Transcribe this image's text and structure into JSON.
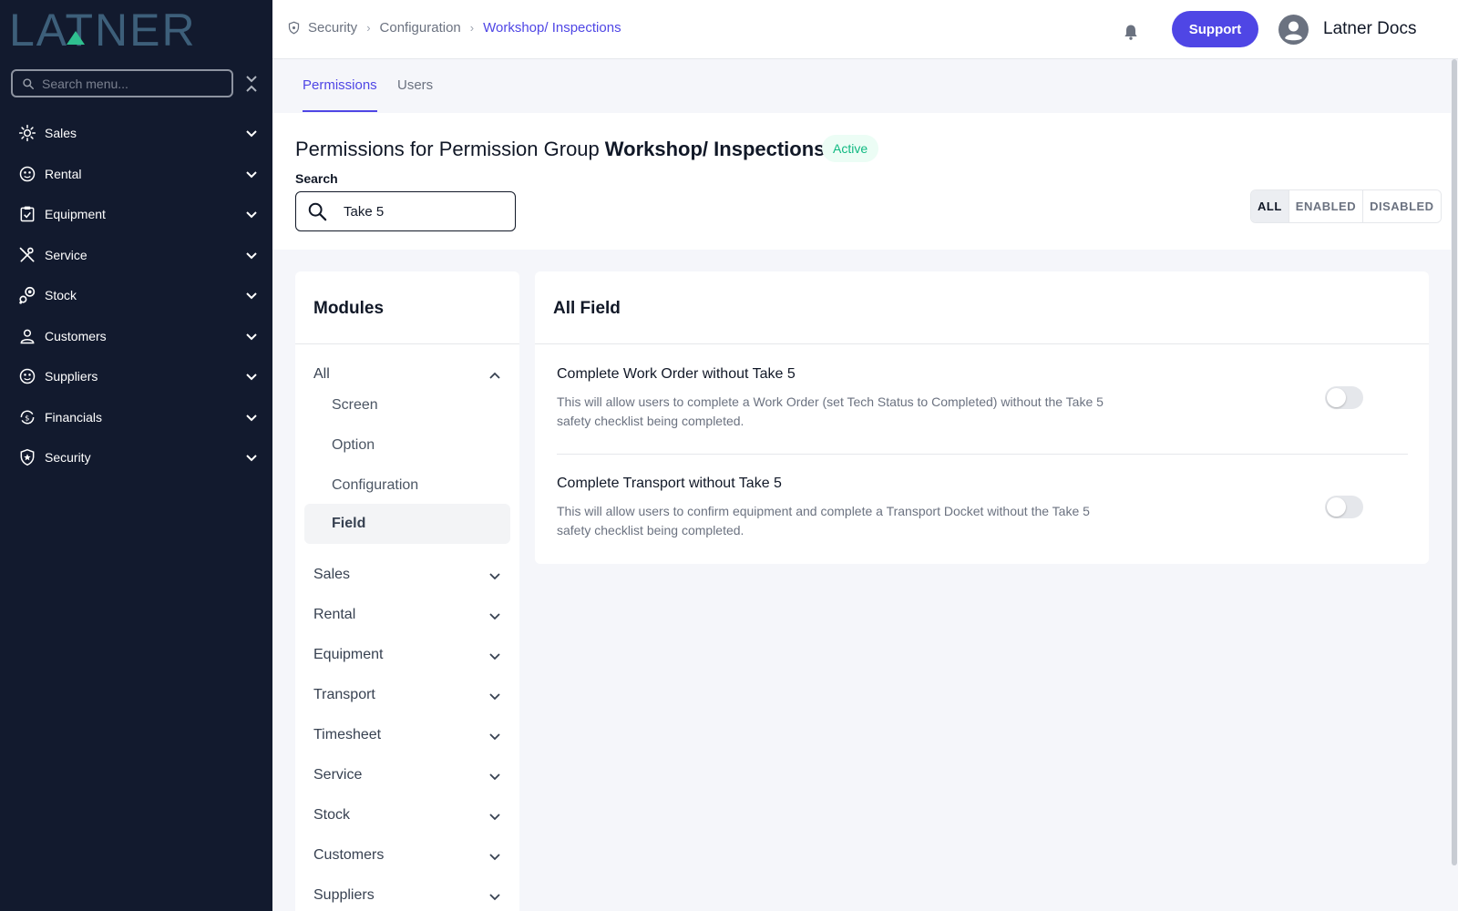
{
  "app": {
    "logo_text": "LATNER",
    "menu_search_placeholder": "Search menu..."
  },
  "sidebar": {
    "items": [
      {
        "label": "Sales",
        "icon": "sales-icon"
      },
      {
        "label": "Rental",
        "icon": "rental-icon"
      },
      {
        "label": "Equipment",
        "icon": "equipment-icon"
      },
      {
        "label": "Service",
        "icon": "service-icon"
      },
      {
        "label": "Stock",
        "icon": "stock-icon"
      },
      {
        "label": "Customers",
        "icon": "customers-icon"
      },
      {
        "label": "Suppliers",
        "icon": "suppliers-icon"
      },
      {
        "label": "Financials",
        "icon": "financials-icon"
      },
      {
        "label": "Security",
        "icon": "security-icon"
      }
    ]
  },
  "header": {
    "breadcrumb": [
      "Security",
      "Configuration",
      "Workshop/ Inspections"
    ],
    "support_label": "Support",
    "user_name": "Latner Docs"
  },
  "tabs": [
    {
      "label": "Permissions",
      "active": true
    },
    {
      "label": "Users",
      "active": false
    }
  ],
  "page": {
    "title_prefix": "Permissions for Permission Group",
    "group_name": "Workshop/ Inspections",
    "status": "Active",
    "search_label": "Search",
    "search_value": "Take 5",
    "filters": [
      "ALL",
      "ENABLED",
      "DISABLED"
    ],
    "active_filter": "ALL"
  },
  "modules": {
    "title": "Modules",
    "all_label": "All",
    "sub_items": [
      "Screen",
      "Option",
      "Configuration",
      "Field"
    ],
    "active_sub": "Field",
    "items": [
      "Sales",
      "Rental",
      "Equipment",
      "Transport",
      "Timesheet",
      "Service",
      "Stock",
      "Customers",
      "Suppliers"
    ]
  },
  "field_panel": {
    "title": "All Field",
    "permissions": [
      {
        "title": "Complete Work Order without Take 5",
        "description": "This will allow users to complete a Work Order (set Tech Status to Completed) without the Take 5 safety checklist being completed.",
        "enabled": false
      },
      {
        "title": "Complete Transport without Take 5",
        "description": "This will allow users to confirm equipment and complete a Transport Docket without the Take 5 safety checklist being completed.",
        "enabled": false
      }
    ]
  },
  "colors": {
    "sidebar_bg": "#121a2e",
    "logo": "#3d5f7a",
    "logo_accent": "#2fbf8f",
    "accent": "#4f46e5",
    "active_badge": "#10b981"
  }
}
